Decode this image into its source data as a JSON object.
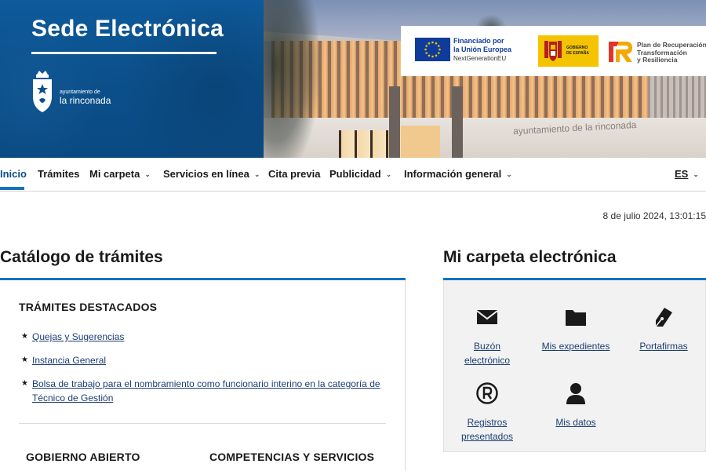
{
  "header": {
    "site_title": "Sede Electrónica",
    "logo": {
      "small": "ayuntamiento de",
      "big": "la rinconada"
    },
    "building_sign": "ayuntamiento de la rinconada",
    "funding": {
      "eu_line1": "Financiado por",
      "eu_line2": "la Unión Europea",
      "eu_sub": "NextGenerationEU",
      "gob_line1": "GOBIERNO",
      "gob_line2": "DE ESPAÑA",
      "prtr_line1": "Plan de Recuperación,",
      "prtr_line2": "Transformación",
      "prtr_line3": "y Resiliencia"
    }
  },
  "nav": {
    "items": [
      {
        "label": "Inicio",
        "active": true
      },
      {
        "label": "Trámites"
      },
      {
        "label": "Mi carpeta"
      },
      {
        "label": "Servicios en línea"
      },
      {
        "label": "Cita previa"
      },
      {
        "label": "Publicidad"
      },
      {
        "label": "Información general"
      }
    ],
    "lang": "ES"
  },
  "datetime": "8 de julio 2024, 13:01:15",
  "catalog": {
    "title": "Catálogo de trámites",
    "featured_title": "TRÁMITES DESTACADOS",
    "featured": [
      {
        "line1": "Quejas y Sugerencias"
      },
      {
        "line1": "Instancia General"
      },
      {
        "line1": "Bolsa de trabajo para el nombramiento como funcionario interino en la categoría de",
        "line2": "Técnico de Gestión"
      }
    ],
    "sub_sections": [
      "GOBIERNO ABIERTO",
      "COMPETENCIAS Y SERVICIOS"
    ]
  },
  "folder": {
    "title": "Mi carpeta electrónica",
    "tiles": [
      {
        "line1": "Buzón",
        "line2": "electrónico",
        "icon": "envelope-icon"
      },
      {
        "line1": "Mis expedientes",
        "icon": "folder-icon"
      },
      {
        "line1": "Portafirmas",
        "icon": "pen-nib-icon"
      },
      {
        "line1": "Registros",
        "line2": "presentados",
        "icon": "registered-icon"
      },
      {
        "line1": "Mis datos",
        "icon": "user-icon"
      }
    ]
  },
  "colors": {
    "primary_blue": "#0b4f8a",
    "accent_blue": "#1672bd",
    "link_blue": "#1b3e73",
    "panel_gray": "#f2f2f2"
  }
}
